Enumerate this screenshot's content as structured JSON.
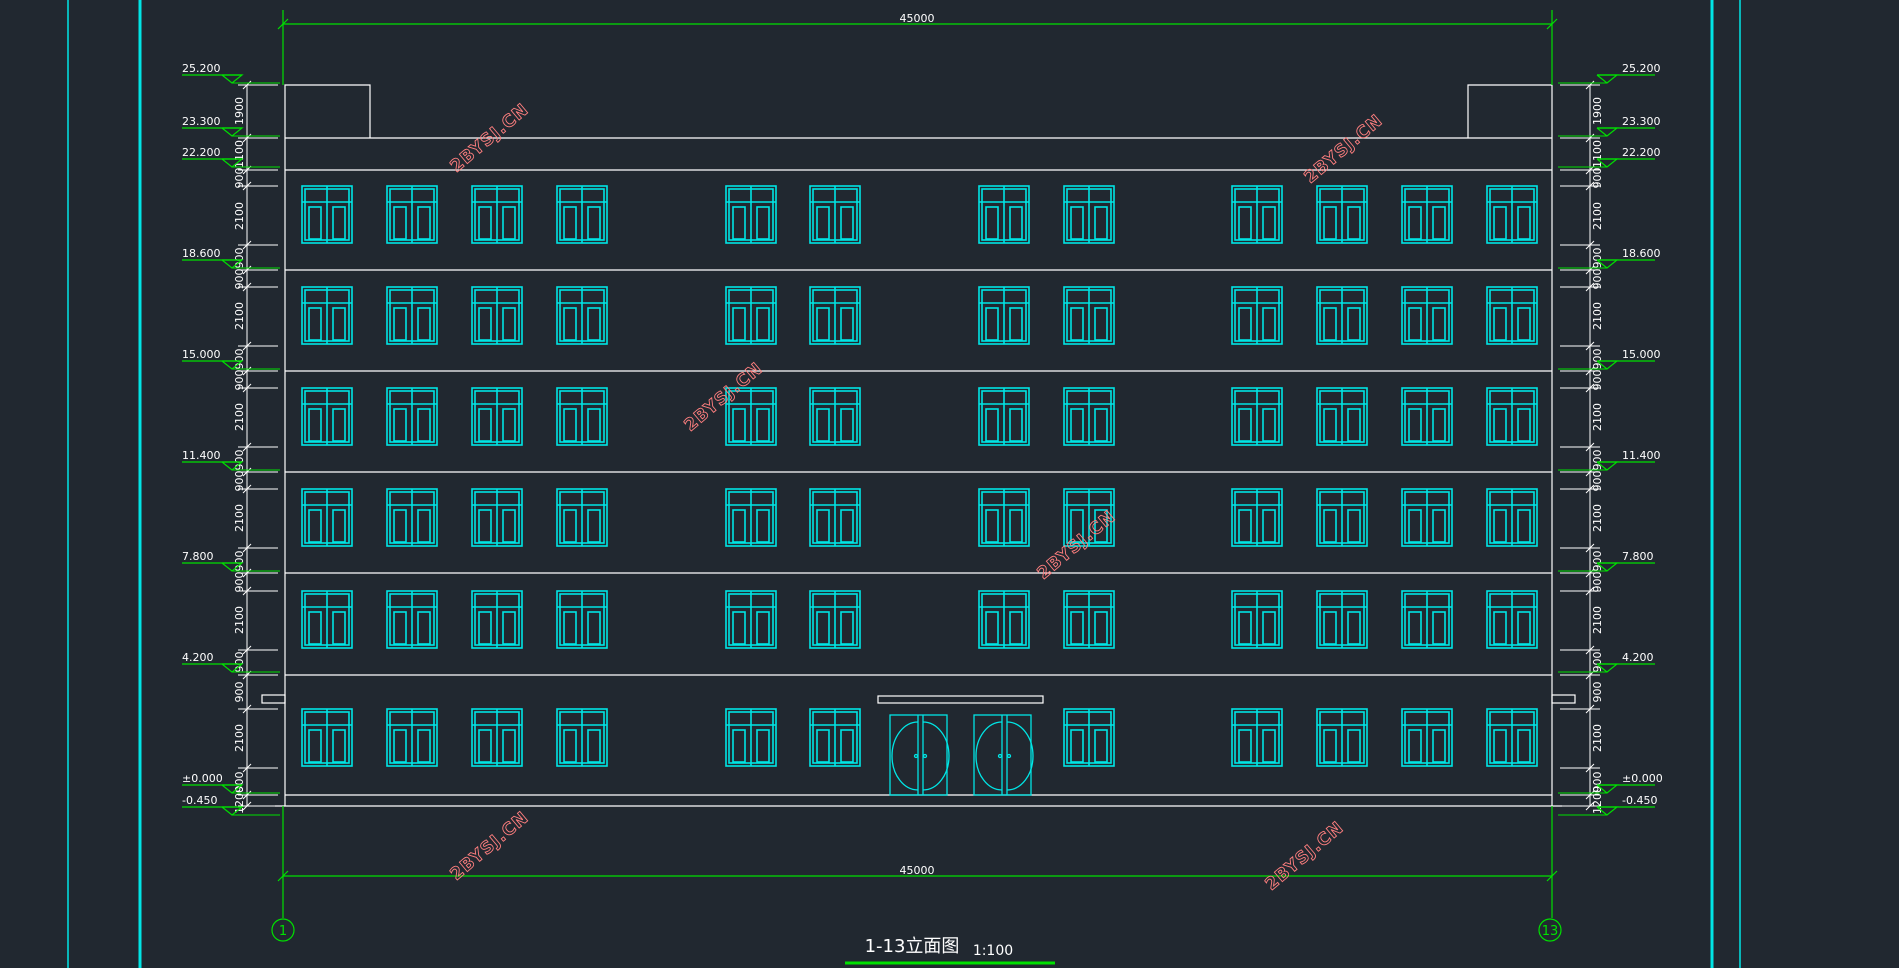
{
  "drawing": {
    "title": "1-13立面图",
    "scale": "1:100",
    "overall_dimension_top": "45000",
    "overall_dimension_bottom": "45000",
    "grid_left": "1",
    "grid_right": "13",
    "watermark": "2BYSJ.CN"
  },
  "levels": [
    "25.200",
    "23.300",
    "22.200",
    "18.600",
    "15.000",
    "11.400",
    "7.800",
    "4.200",
    "±0.000",
    "-0.450"
  ],
  "segment_dimensions": [
    "1900",
    "1100",
    "900",
    "2100",
    "900",
    "900",
    "2100",
    "900",
    "900",
    "2100",
    "900",
    "900",
    "2100",
    "900",
    "900",
    "2100",
    "900",
    "900",
    "2100",
    "900",
    "1200",
    "2100",
    "900",
    "450"
  ],
  "colors": {
    "background": "#212830",
    "window": "#00e5e5",
    "dimension": "#00e000",
    "outline": "#ffffff",
    "frame": "#00e5e5",
    "watermark": "#ff7f7f"
  }
}
